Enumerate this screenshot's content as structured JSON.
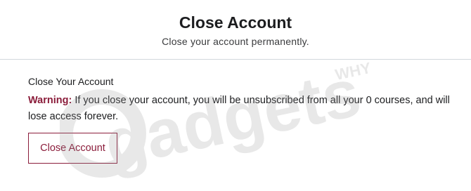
{
  "header": {
    "title": "Close Account",
    "subtitle": "Close your account permanently."
  },
  "section": {
    "heading": "Close Your Account",
    "warning_label": "Warning:",
    "warning_text": " If you close your account, you will be unsubscribed from all your 0 courses, and will lose access forever."
  },
  "actions": {
    "close_button_label": "Close Account"
  },
  "watermark": {
    "text": "gadgets",
    "subtext": "WHY"
  },
  "colors": {
    "accent": "#8b1d3b",
    "divider": "#d1d7dc",
    "text": "#1c1d1f"
  }
}
